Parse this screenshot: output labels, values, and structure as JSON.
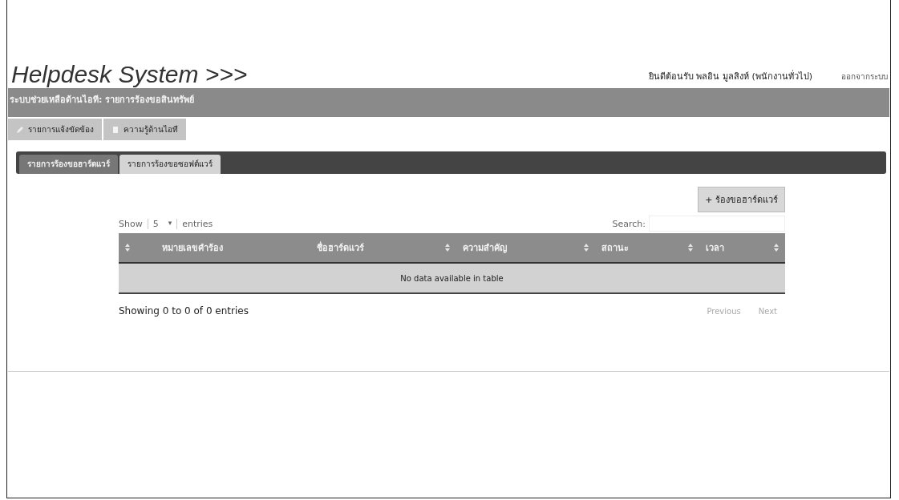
{
  "header": {
    "title": "Helpdesk System >>>",
    "welcome": "ยินดีต้อนรับ  พลอิน มูลสิงห์ (พนักงานทั่วไป)",
    "logout": "ออกจากระบบ"
  },
  "breadcrumb": "ระบบช่วยเหลือด้านไอที: รายการร้องขอสินทรัพย์",
  "nav": [
    {
      "label": "รายการแจ้งขัดข้อง",
      "kind": "pencil"
    },
    {
      "label": "ความรู้ด้านไอที",
      "kind": "doc"
    }
  ],
  "tabs": [
    {
      "label": "รายการร้องขอฮาร์ดแวร์",
      "selected": true
    },
    {
      "label": "รายการร้องขอซอฟต์แวร์",
      "selected": false
    }
  ],
  "add_button": "+ ร้องขอฮาร์ดแวร์",
  "length_menu": {
    "show": "Show",
    "value": "5",
    "caret": "▾",
    "entries": "entries"
  },
  "search": {
    "label": "Search:"
  },
  "table": {
    "columns": [
      {
        "sortable": true
      },
      {
        "label": "หมายเลขคำร้อง",
        "sortable": false
      },
      {
        "label": "ชื่อฮาร์ดแวร์",
        "sortable": true
      },
      {
        "label": "ความสำคัญ",
        "sortable": true
      },
      {
        "label": "สถานะ",
        "sortable": true
      },
      {
        "label": "เวลา",
        "sortable": true
      }
    ],
    "empty": "No data available in table"
  },
  "info": "Showing 0 to 0 of 0 entries",
  "pager": {
    "previous": "Previous",
    "next": "Next"
  }
}
